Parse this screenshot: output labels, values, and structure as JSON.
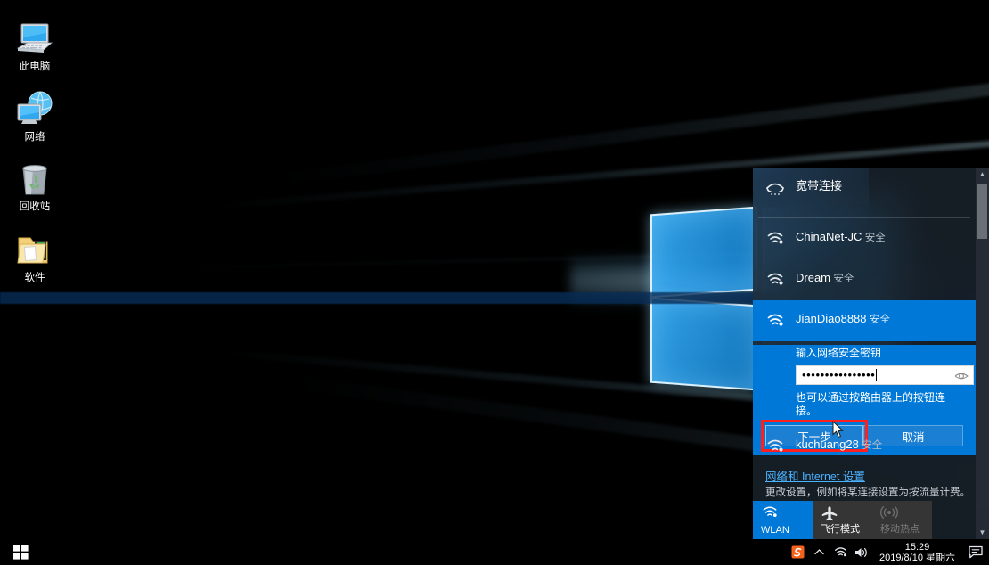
{
  "desktop": {
    "icons": [
      {
        "label": "此电脑",
        "icon": "this-pc-icon"
      },
      {
        "label": "网络",
        "icon": "network-globe-icon"
      },
      {
        "label": "回收站",
        "icon": "recycle-bin-icon"
      },
      {
        "label": "软件",
        "icon": "folder-icon"
      }
    ]
  },
  "flyout": {
    "networks": [
      {
        "name": "宽带连接",
        "status": "",
        "icon": "broadband-modem-icon",
        "selected": false
      },
      {
        "name": "ChinaNet-JC",
        "status": "安全",
        "icon": "wifi-icon",
        "selected": false
      },
      {
        "name": "Dream",
        "status": "安全",
        "icon": "wifi-icon",
        "selected": false
      },
      {
        "name": "JianDiao8888",
        "status": "安全",
        "icon": "wifi-icon",
        "selected": true
      },
      {
        "name": "kuchuang28",
        "status": "安全",
        "icon": "wifi-icon",
        "selected": false
      }
    ],
    "connect_form": {
      "label": "输入网络安全密钥",
      "password_value": "••••••••••••••••",
      "password_placeholder": "",
      "reveal_icon": "eye-icon",
      "hint": "也可以通过按路由器上的按钮连接。",
      "next_label": "下一步",
      "cancel_label": "取消",
      "highlight_color": "#ff1f1f",
      "accent_color": "#0078d7"
    },
    "settings": {
      "link": "网络和 Internet 设置",
      "subtitle": "更改设置，例如将某连接设置为按流量计费。"
    },
    "tiles": [
      {
        "label": "WLAN",
        "icon": "wifi-icon",
        "state": "on"
      },
      {
        "label": "飞行模式",
        "icon": "airplane-icon",
        "state": "off"
      },
      {
        "label": "移动热点",
        "icon": "hotspot-icon",
        "state": "disabled"
      }
    ],
    "scrollbar": {
      "up": "▲",
      "down": "▼"
    }
  },
  "taskbar": {
    "start_icon": "windows-start-icon",
    "tray": [
      {
        "name": "sogou-ime-icon",
        "glyph": "S"
      },
      {
        "name": "show-hidden-icons-chevron",
        "glyph": "∧"
      },
      {
        "name": "wifi-tray-icon",
        "glyph": ""
      },
      {
        "name": "volume-icon",
        "glyph": ""
      }
    ],
    "clock": {
      "time": "15:29",
      "date": "2019/8/10 星期六"
    },
    "action_center_icon": "action-center-icon"
  }
}
